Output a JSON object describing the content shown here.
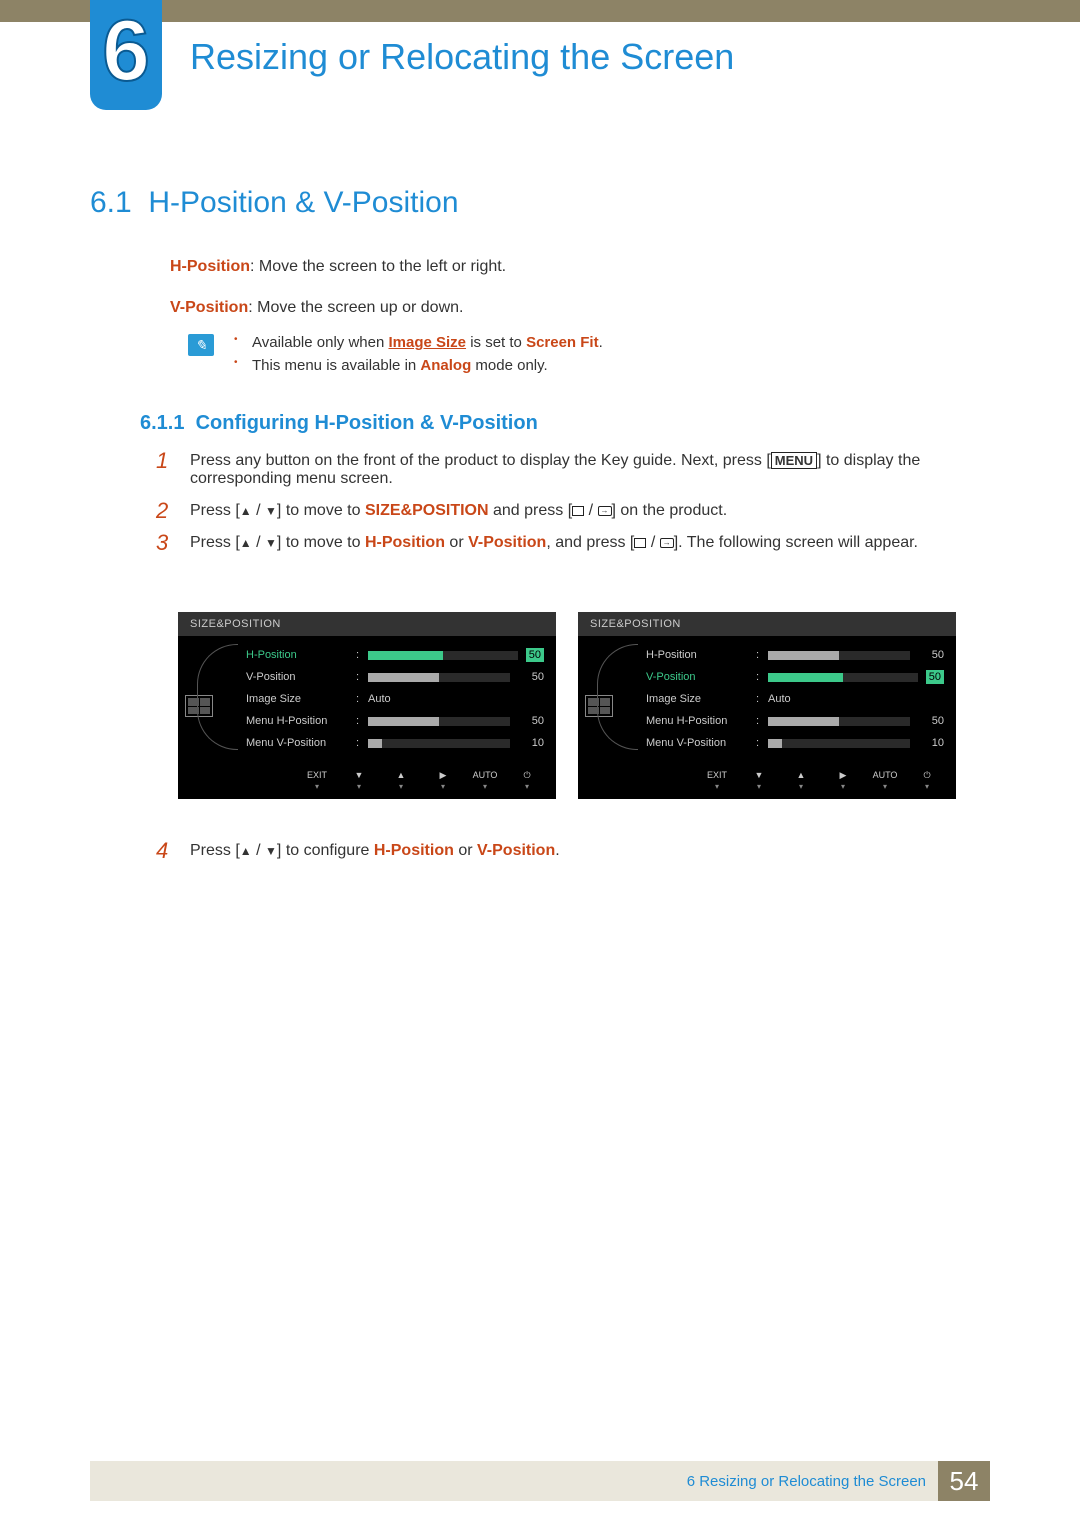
{
  "chapter": {
    "number": "6",
    "title": "Resizing or Relocating the Screen"
  },
  "section": {
    "number": "6.1",
    "title": "H-Position & V-Position"
  },
  "definitions": {
    "hpos_term": "H-Position",
    "hpos_text": ": Move the screen to the left or right.",
    "vpos_term": "V-Position",
    "vpos_text": ": Move the screen up or down."
  },
  "notes": {
    "n1_pre": "Available only when ",
    "n1_link": "Image Size",
    "n1_mid": " is set to ",
    "n1_bold": "Screen Fit",
    "n1_post": ".",
    "n2_pre": "This menu is available in ",
    "n2_bold": "Analog",
    "n2_post": " mode only."
  },
  "subsection": {
    "number": "6.1.1",
    "title": "Configuring H-Position & V-Position"
  },
  "steps": {
    "s1_a": "Press any button on the front of the product to display the Key guide. Next, press [",
    "s1_menu": "MENU",
    "s1_b": "] to display the corresponding menu screen.",
    "s2_a": "Press [",
    "s2_b": "] to move to ",
    "s2_bold": "SIZE&POSITION",
    "s2_c": " and press [",
    "s2_d": "] on the product.",
    "s3_a": "Press [",
    "s3_b": "] to move to ",
    "s3_h": "H-Position",
    "s3_or": " or ",
    "s3_v": "V-Position",
    "s3_c": ", and press [",
    "s3_d": "]. The following screen will appear.",
    "s4_a": "Press [",
    "s4_b": "] to configure ",
    "s4_h": "H-Position",
    "s4_or": " or ",
    "s4_v": "V-Position",
    "s4_c": "."
  },
  "osd": {
    "header": "SIZE&POSITION",
    "rows": [
      {
        "label": "H-Position",
        "value": "50",
        "fill": 50
      },
      {
        "label": "V-Position",
        "value": "50",
        "fill": 50
      },
      {
        "label": "Image Size",
        "text": "Auto"
      },
      {
        "label": "Menu H-Position",
        "value": "50",
        "fill": 50
      },
      {
        "label": "Menu V-Position",
        "value": "10",
        "fill": 10
      }
    ],
    "footer": [
      "EXIT",
      "▼",
      "▲",
      "▶",
      "AUTO",
      "⏻"
    ],
    "left_active": 0,
    "right_active": 1
  },
  "footer": {
    "text": "6 Resizing or Relocating the Screen",
    "page": "54"
  }
}
